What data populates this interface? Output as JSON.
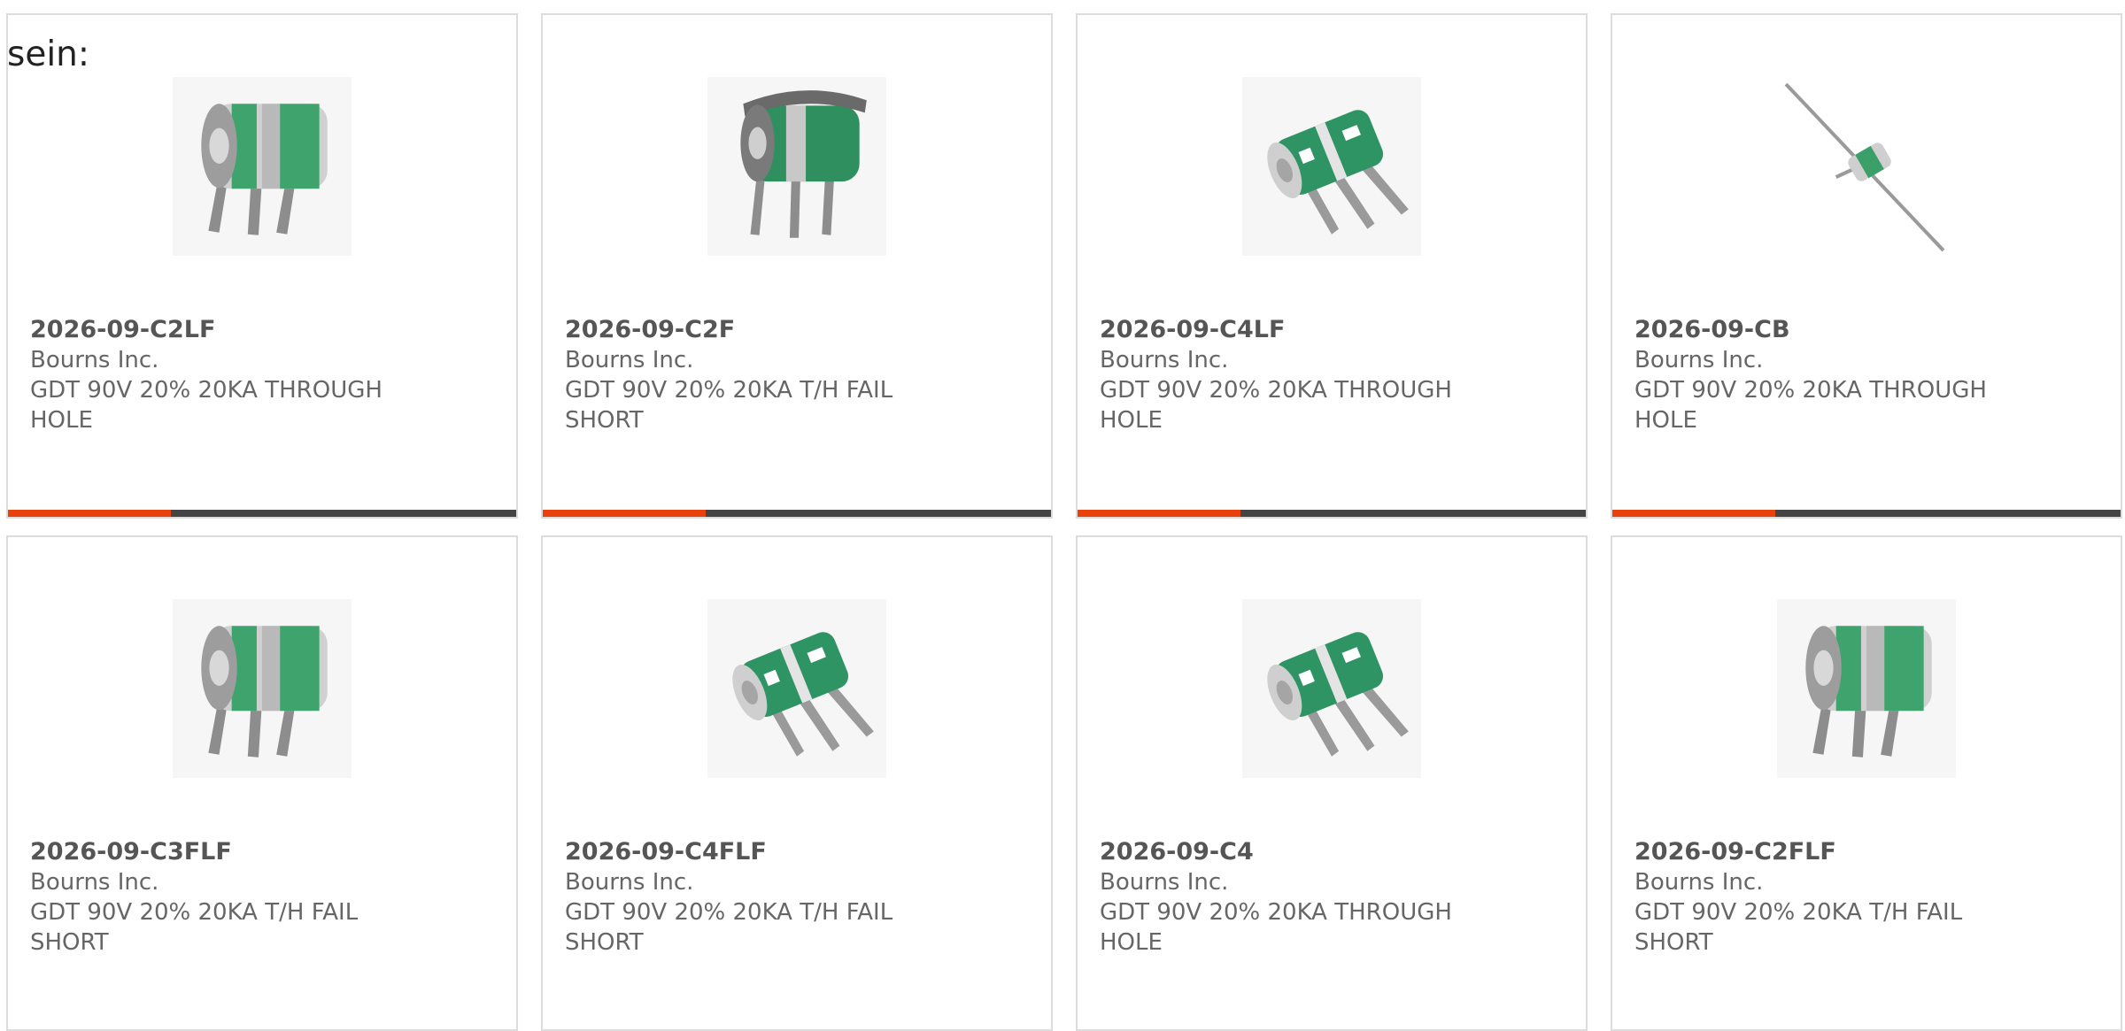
{
  "prefix_label": "sein:",
  "colors": {
    "progress_fill": "#e8410e",
    "progress_track": "#444444",
    "card_border": "#dcdcdc"
  },
  "products": [
    {
      "part_number": "2026-09-C2LF",
      "manufacturer": "Bourns Inc.",
      "description": "GDT 90V 20% 20KA THROUGH HOLE",
      "image_icon": "3-lead-gdt-green-band-icon",
      "progress": 0.32
    },
    {
      "part_number": "2026-09-C2F",
      "manufacturer": "Bourns Inc.",
      "description": "GDT 90V 20% 20KA T/H FAIL SHORT",
      "image_icon": "3-lead-gdt-failsafe-clip-icon",
      "progress": 0.32
    },
    {
      "part_number": "2026-09-C4LF",
      "manufacturer": "Bourns Inc.",
      "description": "GDT 90V 20% 20KA THROUGH HOLE",
      "image_icon": "3-lead-gdt-angled-icon",
      "progress": 0.32
    },
    {
      "part_number": "2026-09-CB",
      "manufacturer": "Bourns Inc.",
      "description": "GDT 90V 20% 20KA THROUGH HOLE",
      "image_icon": "axial-gdt-icon",
      "progress": 0.32
    },
    {
      "part_number": "2026-09-C3FLF",
      "manufacturer": "Bourns Inc.",
      "description": "GDT 90V 20% 20KA T/H FAIL SHORT",
      "image_icon": "3-lead-gdt-green-band-icon"
    },
    {
      "part_number": "2026-09-C4FLF",
      "manufacturer": "Bourns Inc.",
      "description": "GDT 90V 20% 20KA T/H FAIL SHORT",
      "image_icon": "3-lead-gdt-angled-icon"
    },
    {
      "part_number": "2026-09-C4",
      "manufacturer": "Bourns Inc.",
      "description": "GDT 90V 20% 20KA THROUGH HOLE",
      "image_icon": "3-lead-gdt-angled-icon"
    },
    {
      "part_number": "2026-09-C2FLF",
      "manufacturer": "Bourns Inc.",
      "description": "GDT 90V 20% 20KA T/H FAIL SHORT",
      "image_icon": "3-lead-gdt-green-band-icon"
    }
  ]
}
